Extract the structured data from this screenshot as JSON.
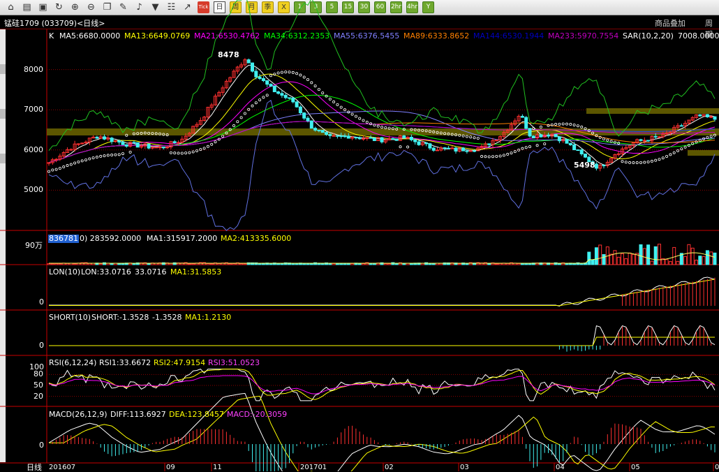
{
  "toolbar": {
    "icons": [
      "home-icon",
      "folder-icon",
      "screen-icon",
      "refresh-icon",
      "zoom-in-icon",
      "zoom-out-icon",
      "copy-icon",
      "pen-icon",
      "bell-icon",
      "filter-icon",
      "table-icon",
      "chart-icon"
    ],
    "tick_label": "Tick",
    "periods": [
      "日",
      "周",
      "月",
      "季",
      "X",
      "1",
      "3",
      "5",
      "15",
      "30",
      "60",
      "2hr",
      "4hr",
      "Y"
    ],
    "selected_period": "日"
  },
  "header": {
    "title": "锰硅1709 (033709)<日线>",
    "overlay_button": "商品叠加",
    "period_button": "周期"
  },
  "main_panel": {
    "indicator_prefix": "K",
    "mas": [
      {
        "text": "MA5:6680.0000",
        "color": "#ffffff"
      },
      {
        "text": "MA13:6649.0769",
        "color": "#ffff00"
      },
      {
        "text": "MA21:6530.4762",
        "color": "#ff00ff"
      },
      {
        "text": "MA34:6312.2353",
        "color": "#00ff00"
      },
      {
        "text": "MA55:6376.5455",
        "color": "#8080ff"
      },
      {
        "text": "MA89:6333.8652",
        "color": "#ff8000"
      },
      {
        "text": "MA144:6530.1944",
        "color": "#0000c0"
      },
      {
        "text": "MA233:5970.7554",
        "color": "#c000c0"
      },
      {
        "text": "SAR(10,2,20)",
        "color": "#ffffff"
      },
      {
        "text": "7008.0000",
        "color": "#ffffff"
      }
    ],
    "y_ticks": [
      "8000",
      "7000",
      "6000",
      "5000"
    ],
    "high_label": "8478",
    "low_label": "5498"
  },
  "volume_panel": {
    "highlight": "836781",
    "text": "0)  283592.0000",
    "ma1": "MA1:315917.2000",
    "ma2": "MA2:413335.6000",
    "y_label": "90万"
  },
  "lon_panel": {
    "name": "LON(10)",
    "value": "LON:33.0716",
    "value2": "33.0716",
    "ma": "MA1:31.5853",
    "y_label": "0"
  },
  "short_panel": {
    "name": "SHORT(10)",
    "value": "SHORT:-1.3528",
    "value2": "-1.3528",
    "ma": "MA1:1.2130",
    "y_label": "0"
  },
  "rsi_panel": {
    "name": "RSI(6,12,24)",
    "rsi1": "RSI1:33.6672",
    "rsi2": "RSI2:47.9154",
    "rsi3": "RSI3:51.0523",
    "y_ticks": [
      "100",
      "80",
      "50",
      "20"
    ]
  },
  "macd_panel": {
    "name": "MACD(26,12,9)",
    "diff": "DIFF:113.6927",
    "dea": "DEA:123.8457",
    "macd": "MACD:-20.3059",
    "y_label": "0"
  },
  "x_axis": {
    "prefix": "日线",
    "labels": [
      "201607",
      "09",
      "11",
      "201701",
      "02",
      "03",
      "04",
      "05",
      "0"
    ]
  },
  "colors": {
    "up": "#ff3030",
    "down": "#40f0f0",
    "grid": "#8b0000",
    "axis": "#c80000"
  }
}
